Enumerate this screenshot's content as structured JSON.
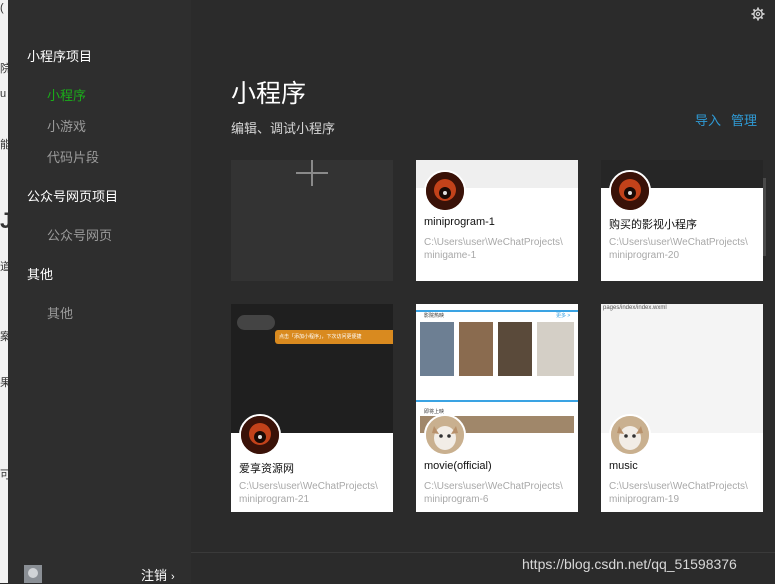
{
  "sidebar": {
    "sections": [
      {
        "title": "小程序项目",
        "items": [
          "小程序",
          "小游戏",
          "代码片段"
        ]
      },
      {
        "title": "公众号网页项目",
        "items": [
          "公众号网页"
        ]
      },
      {
        "title": "其他",
        "items": [
          "其他"
        ]
      }
    ],
    "active_item": "小程序",
    "logout_label": "注销",
    "logout_chevron": "›"
  },
  "header": {
    "title": "小程序",
    "subtitle": "编辑、调试小程序",
    "import_label": "导入",
    "manage_label": "管理"
  },
  "projects": [
    {
      "name": "miniprogram-1",
      "path_line1": "C:\\Users\\user\\WeChatProjects\\",
      "path_line2": "minigame-1"
    },
    {
      "name": "购买的影视小程序",
      "path_line1": "C:\\Users\\user\\WeChatProjects\\",
      "path_line2": "miniprogram-20"
    },
    {
      "name": "爱享资源网",
      "path_line1": "C:\\Users\\user\\WeChatProjects\\",
      "path_line2": "miniprogram-21"
    },
    {
      "name": "movie(official)",
      "path_line1": "C:\\Users\\user\\WeChatProjects\\",
      "path_line2": "miniprogram-6"
    },
    {
      "name": "music",
      "path_line1": "C:\\Users\\user\\WeChatProjects\\",
      "path_line2": "miniprogram-19"
    }
  ],
  "thumbnails": {
    "dark_tooltip": "点击「添加小程序」，下次访问更便捷",
    "movie_header": "影院热映",
    "movie_more": "更多 >",
    "movie_header2": "即将上映",
    "music_path": "pages/index/index.wxml"
  },
  "watermark": "https://blog.csdn.net/qq_51598376",
  "colors": {
    "accent_green": "#1aad19",
    "link_blue": "#2f9bd6",
    "background": "#2b2b2b"
  }
}
